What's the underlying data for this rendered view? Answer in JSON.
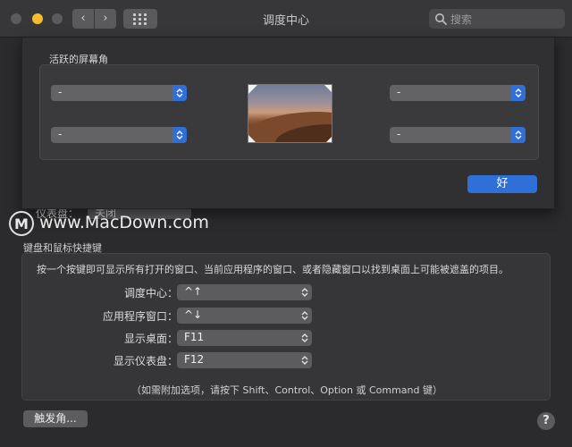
{
  "window": {
    "title": "调度中心"
  },
  "toolbar": {
    "back_icon": "‹",
    "forward_icon": "›",
    "search_placeholder": "搜索"
  },
  "sheet": {
    "title": "活跃的屏幕角",
    "corners": {
      "top_left": "-",
      "bottom_left": "-",
      "top_right": "-",
      "bottom_right": "-"
    },
    "ok_label": "好"
  },
  "dashboard": {
    "label": "仪表盘：",
    "value": "关闭"
  },
  "watermark": {
    "text": "www.MacDown.com",
    "logo": "M"
  },
  "keyboard": {
    "section_title": "键盘和鼠标快捷键",
    "description": "按一个按键即可显示所有打开的窗口、当前应用程序的窗口、或者隐藏窗口以找到桌面上可能被遮盖的项目。",
    "rows": [
      {
        "label": "调度中心：",
        "value": "^↑"
      },
      {
        "label": "应用程序窗口：",
        "value": "^↓"
      },
      {
        "label": "显示桌面：",
        "value": "F11"
      },
      {
        "label": "显示仪表盘：",
        "value": "F12"
      }
    ],
    "note": "（如需附加选项，请按下 Shift、Control、Option 或 Command 键）"
  },
  "footer": {
    "hot_corners_label": "触发角...",
    "help_label": "?"
  },
  "colors": {
    "accent": "#2e6fd8",
    "traffic_yellow": "#f4bc2f",
    "background": "#2b2b2d"
  }
}
